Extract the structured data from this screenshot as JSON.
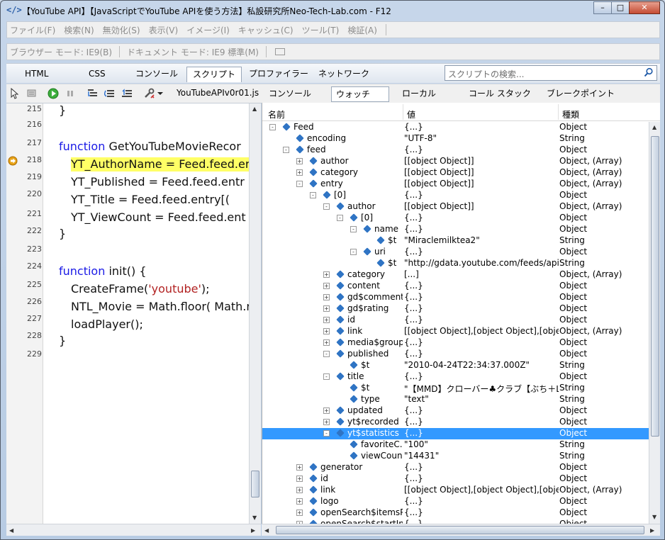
{
  "window": {
    "title": "【YouTube API】【JavaScriptでYouTube APIを使う方法】私設研究所Neo-Tech-Lab.com - F12",
    "minimize": "–",
    "maximize": "□",
    "close": "✕"
  },
  "menu": [
    "ファイル(F)",
    "検索(N)",
    "無効化(S)",
    "表示(V)",
    "イメージ(I)",
    "キャッシュ(C)",
    "ツール(T)",
    "検証(A)"
  ],
  "mode": {
    "browser": "ブラウザー モード: IE9(B)",
    "document": "ドキュメント モード: IE9 標準(M)"
  },
  "tabs": [
    "HTML",
    "CSS",
    "コンソール",
    "スクリプト",
    "プロファイラー",
    "ネットワーク"
  ],
  "active_tab": "スクリプト",
  "search": {
    "placeholder": "スクリプトの検索..."
  },
  "toolbar": {
    "file": "YouTubeAPIv0r01.js"
  },
  "subtabs": [
    "コンソール",
    "ウォッチ",
    "ローカル",
    "コール スタック",
    "ブレークポイント"
  ],
  "code": {
    "line_numbers": [
      "215",
      "216",
      "217",
      "218",
      "219",
      "220",
      "221",
      "222",
      "223",
      "224",
      "225",
      "226",
      "227",
      "228",
      "229"
    ],
    "l215": "}",
    "l217_kw": "function",
    "l217_rest": " GetYouTubeMovieRecor",
    "l218": "YT_AuthorName = Feed.feed.er",
    "l219": "YT_Published  = Feed.feed.entr",
    "l220": "YT_Title      = Feed.feed.entry[(",
    "l221": "YT_ViewCount  = Feed.feed.ent",
    "l222": "}",
    "l224_kw": "function",
    "l224_rest": " init() {",
    "l225_a": "CreateFrame(",
    "l225_str": "'youtube'",
    "l225_b": ");",
    "l226": "NTL_Movie = Math.floor( Math.r",
    "l227": "loadPlayer();",
    "l228": "}"
  },
  "watch": {
    "headers": {
      "name": "名前",
      "value": "値",
      "type": "種類"
    },
    "rows": [
      {
        "name": "Feed",
        "value": "{...}",
        "type": "Object"
      },
      {
        "name": "encoding",
        "value": "\"UTF-8\"",
        "type": "String"
      },
      {
        "name": "feed",
        "value": "{...}",
        "type": "Object"
      },
      {
        "name": "author",
        "value": "[[object Object]]",
        "type": "Object, (Array)"
      },
      {
        "name": "category",
        "value": "[[object Object]]",
        "type": "Object, (Array)"
      },
      {
        "name": "entry",
        "value": "[[object Object]]",
        "type": "Object, (Array)"
      },
      {
        "name": "[0]",
        "value": "{...}",
        "type": "Object"
      },
      {
        "name": "author",
        "value": "[[object Object]]",
        "type": "Object, (Array)"
      },
      {
        "name": "[0]",
        "value": "{...}",
        "type": "Object"
      },
      {
        "name": "name",
        "value": "{...}",
        "type": "Object"
      },
      {
        "name": "$t",
        "value": "\"Miraclemilktea2\"",
        "type": "String"
      },
      {
        "name": "uri",
        "value": "{...}",
        "type": "Object"
      },
      {
        "name": "$t",
        "value": "\"http://gdata.youtube.com/feeds/api/use...",
        "type": "String"
      },
      {
        "name": "category",
        "value": "[...]",
        "type": "Object, (Array)"
      },
      {
        "name": "content",
        "value": "{...}",
        "type": "Object"
      },
      {
        "name": "gd$comments",
        "value": "{...}",
        "type": "Object"
      },
      {
        "name": "gd$rating",
        "value": "{...}",
        "type": "Object"
      },
      {
        "name": "id",
        "value": "{...}",
        "type": "Object"
      },
      {
        "name": "link",
        "value": "[[object Object],[object Object],[object O...",
        "type": "Object, (Array)"
      },
      {
        "name": "media$group",
        "value": "{...}",
        "type": "Object"
      },
      {
        "name": "published",
        "value": "{...}",
        "type": "Object"
      },
      {
        "name": "$t",
        "value": "\"2010-04-24T22:34:37.000Z\"",
        "type": "String"
      },
      {
        "name": "title",
        "value": "{...}",
        "type": "Object"
      },
      {
        "name": "$t",
        "value": "\"【MMD】クローバー♣クラブ【ぶち＋Lat式】[H...",
        "type": "String"
      },
      {
        "name": "type",
        "value": "\"text\"",
        "type": "String"
      },
      {
        "name": "updated",
        "value": "{...}",
        "type": "Object"
      },
      {
        "name": "yt$recorded",
        "value": "{...}",
        "type": "Object"
      },
      {
        "name": "yt$statistics",
        "value": "{...}",
        "type": "Object"
      },
      {
        "name": "favoriteC...",
        "value": "\"100\"",
        "type": "String"
      },
      {
        "name": "viewCount",
        "value": "\"14431\"",
        "type": "String"
      },
      {
        "name": "generator",
        "value": "{...}",
        "type": "Object"
      },
      {
        "name": "id",
        "value": "{...}",
        "type": "Object"
      },
      {
        "name": "link",
        "value": "[[object Object],[object Object],[object O...",
        "type": "Object, (Array)"
      },
      {
        "name": "logo",
        "value": "{...}",
        "type": "Object"
      },
      {
        "name": "openSearch$itemsP...",
        "value": "{...}",
        "type": "Object"
      },
      {
        "name": "openSearch$startInd...",
        "value": "{...}",
        "type": "Object"
      }
    ]
  }
}
